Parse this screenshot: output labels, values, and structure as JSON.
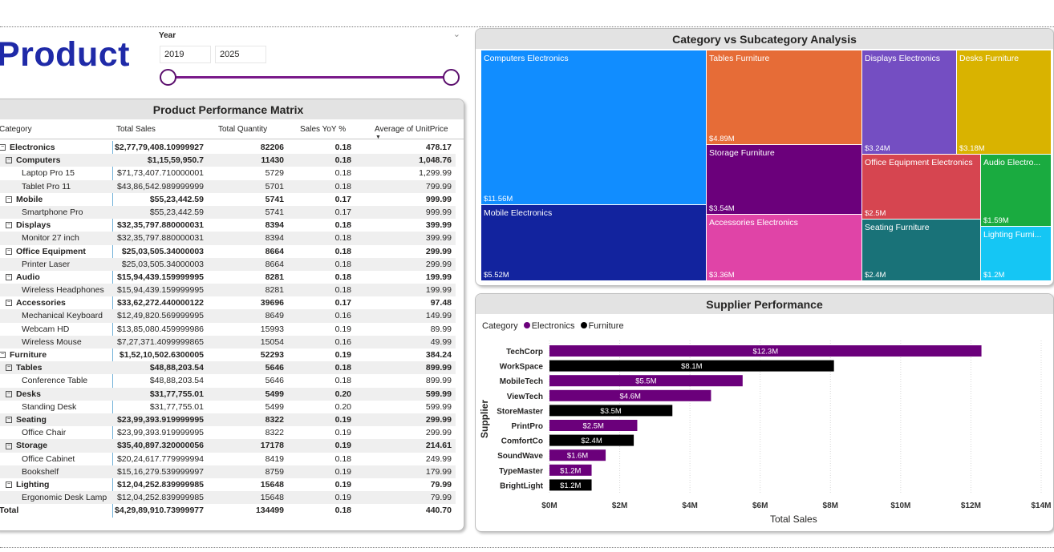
{
  "page_title": "Product",
  "slicer": {
    "label": "Year",
    "start": "2019",
    "end": "2025"
  },
  "matrix": {
    "title": "Product Performance Matrix",
    "columns": [
      "Category",
      "Total Sales",
      "Total Quantity",
      "Sales YoY %",
      "Average of UnitPrice"
    ],
    "rows": [
      {
        "level": 0,
        "toggle": "⊟",
        "name": "Electronics",
        "sales": "$2,77,79,408.10999927",
        "qty": "82206",
        "yoy": "0.18",
        "avg": "478.17"
      },
      {
        "level": 1,
        "toggle": "⊟",
        "name": "Computers",
        "sales": "$1,15,59,950.7",
        "qty": "11430",
        "yoy": "0.18",
        "avg": "1,048.76"
      },
      {
        "level": 2,
        "name": "Laptop Pro 15",
        "sales": "$71,73,407.710000001",
        "qty": "5729",
        "yoy": "0.18",
        "avg": "1,299.99"
      },
      {
        "level": 2,
        "name": "Tablet Pro 11",
        "sales": "$43,86,542.989999999",
        "qty": "5701",
        "yoy": "0.18",
        "avg": "799.99"
      },
      {
        "level": 1,
        "toggle": "⊟",
        "name": "Mobile",
        "sales": "$55,23,442.59",
        "qty": "5741",
        "yoy": "0.17",
        "avg": "999.99"
      },
      {
        "level": 2,
        "name": "Smartphone Pro",
        "sales": "$55,23,442.59",
        "qty": "5741",
        "yoy": "0.17",
        "avg": "999.99"
      },
      {
        "level": 1,
        "toggle": "⊟",
        "name": "Displays",
        "sales": "$32,35,797.880000031",
        "qty": "8394",
        "yoy": "0.18",
        "avg": "399.99"
      },
      {
        "level": 2,
        "name": "Monitor 27 inch",
        "sales": "$32,35,797.880000031",
        "qty": "8394",
        "yoy": "0.18",
        "avg": "399.99"
      },
      {
        "level": 1,
        "toggle": "⊟",
        "name": "Office Equipment",
        "sales": "$25,03,505.34000003",
        "qty": "8664",
        "yoy": "0.18",
        "avg": "299.99"
      },
      {
        "level": 2,
        "name": "Printer Laser",
        "sales": "$25,03,505.34000003",
        "qty": "8664",
        "yoy": "0.18",
        "avg": "299.99"
      },
      {
        "level": 1,
        "toggle": "⊟",
        "name": "Audio",
        "sales": "$15,94,439.159999995",
        "qty": "8281",
        "yoy": "0.18",
        "avg": "199.99"
      },
      {
        "level": 2,
        "name": "Wireless Headphones",
        "sales": "$15,94,439.159999995",
        "qty": "8281",
        "yoy": "0.18",
        "avg": "199.99"
      },
      {
        "level": 1,
        "toggle": "⊟",
        "name": "Accessories",
        "sales": "$33,62,272.440000122",
        "qty": "39696",
        "yoy": "0.17",
        "avg": "97.48"
      },
      {
        "level": 2,
        "name": "Mechanical Keyboard",
        "sales": "$12,49,820.569999995",
        "qty": "8649",
        "yoy": "0.16",
        "avg": "149.99"
      },
      {
        "level": 2,
        "name": "Webcam HD",
        "sales": "$13,85,080.459999986",
        "qty": "15993",
        "yoy": "0.19",
        "avg": "89.99"
      },
      {
        "level": 2,
        "name": "Wireless Mouse",
        "sales": "$7,27,371.4099999865",
        "qty": "15054",
        "yoy": "0.16",
        "avg": "49.99"
      },
      {
        "level": 0,
        "toggle": "⊟",
        "name": "Furniture",
        "sales": "$1,52,10,502.6300005",
        "qty": "52293",
        "yoy": "0.19",
        "avg": "384.24"
      },
      {
        "level": 1,
        "toggle": "⊟",
        "name": "Tables",
        "sales": "$48,88,203.54",
        "qty": "5646",
        "yoy": "0.18",
        "avg": "899.99"
      },
      {
        "level": 2,
        "name": "Conference Table",
        "sales": "$48,88,203.54",
        "qty": "5646",
        "yoy": "0.18",
        "avg": "899.99"
      },
      {
        "level": 1,
        "toggle": "⊟",
        "name": "Desks",
        "sales": "$31,77,755.01",
        "qty": "5499",
        "yoy": "0.20",
        "avg": "599.99"
      },
      {
        "level": 2,
        "name": "Standing Desk",
        "sales": "$31,77,755.01",
        "qty": "5499",
        "yoy": "0.20",
        "avg": "599.99"
      },
      {
        "level": 1,
        "toggle": "⊟",
        "name": "Seating",
        "sales": "$23,99,393.919999995",
        "qty": "8322",
        "yoy": "0.19",
        "avg": "299.99"
      },
      {
        "level": 2,
        "name": "Office Chair",
        "sales": "$23,99,393.919999995",
        "qty": "8322",
        "yoy": "0.19",
        "avg": "299.99"
      },
      {
        "level": 1,
        "toggle": "⊟",
        "name": "Storage",
        "sales": "$35,40,897.320000056",
        "qty": "17178",
        "yoy": "0.19",
        "avg": "214.61"
      },
      {
        "level": 2,
        "name": "Office Cabinet",
        "sales": "$20,24,617.779999994",
        "qty": "8419",
        "yoy": "0.18",
        "avg": "249.99"
      },
      {
        "level": 2,
        "name": "Bookshelf",
        "sales": "$15,16,279.539999997",
        "qty": "8759",
        "yoy": "0.19",
        "avg": "179.99"
      },
      {
        "level": 1,
        "toggle": "⊟",
        "name": "Lighting",
        "sales": "$12,04,252.839999985",
        "qty": "15648",
        "yoy": "0.19",
        "avg": "79.99"
      },
      {
        "level": 2,
        "name": "Ergonomic Desk Lamp",
        "sales": "$12,04,252.839999985",
        "qty": "15648",
        "yoy": "0.19",
        "avg": "79.99"
      },
      {
        "level": 0,
        "name": "Total",
        "sales": "$4,29,89,910.73999977",
        "qty": "134499",
        "yoy": "0.18",
        "avg": "440.70"
      }
    ]
  },
  "treemap": {
    "title": "Category vs Subcategory Analysis",
    "tiles": [
      {
        "name": "Computers Electronics",
        "value": "$11.56M",
        "color": "#118dff"
      },
      {
        "name": "Mobile Electronics",
        "value": "$5.52M",
        "color": "#12239e"
      },
      {
        "name": "Tables Furniture",
        "value": "$4.89M",
        "color": "#e66c37"
      },
      {
        "name": "Storage Furniture",
        "value": "$3.54M",
        "color": "#6b007b"
      },
      {
        "name": "Accessories Electronics",
        "value": "$3.36M",
        "color": "#e044a7"
      },
      {
        "name": "Displays Electronics",
        "value": "$3.24M",
        "color": "#744ec2"
      },
      {
        "name": "Desks Furniture",
        "value": "$3.18M",
        "color": "#d9b300"
      },
      {
        "name": "Office Equipment Electronics",
        "value": "$2.5M",
        "color": "#d64550"
      },
      {
        "name": "Audio Electro...",
        "value": "$1.59M",
        "color": "#1aab40"
      },
      {
        "name": "Seating Furniture",
        "value": "$2.4M",
        "color": "#197278"
      },
      {
        "name": "Lighting Furni...",
        "value": "$1.2M",
        "color": "#15c6f4"
      }
    ]
  },
  "supplier": {
    "title": "Supplier Performance",
    "legend_title": "Category",
    "legend": [
      {
        "name": "Electronics",
        "color": "#6b007b"
      },
      {
        "name": "Furniture",
        "color": "#000000"
      }
    ],
    "ylabel": "Supplier",
    "xlabel": "Total Sales"
  },
  "chart_data": {
    "type": "bar",
    "orientation": "horizontal",
    "title": "Supplier Performance",
    "xlabel": "Total Sales",
    "ylabel": "Supplier",
    "xlim": [
      0,
      14
    ],
    "x_ticks": [
      "$0M",
      "$2M",
      "$4M",
      "$6M",
      "$8M",
      "$10M",
      "$12M",
      "$14M"
    ],
    "categories": [
      "TechCorp",
      "WorkSpace",
      "MobileTech",
      "ViewTech",
      "StoreMaster",
      "PrintPro",
      "ComfortCo",
      "SoundWave",
      "TypeMaster",
      "BrightLight"
    ],
    "values": [
      12.3,
      8.1,
      5.5,
      4.6,
      3.5,
      2.5,
      2.4,
      1.6,
      1.2,
      1.2
    ],
    "labels": [
      "$12.3M",
      "$8.1M",
      "$5.5M",
      "$4.6M",
      "$3.5M",
      "$2.5M",
      "$2.4M",
      "$1.6M",
      "$1.2M",
      "$1.2M"
    ],
    "series_of_bar": [
      "Electronics",
      "Furniture",
      "Electronics",
      "Electronics",
      "Furniture",
      "Electronics",
      "Furniture",
      "Electronics",
      "Electronics",
      "Furniture"
    ],
    "grid": true
  }
}
